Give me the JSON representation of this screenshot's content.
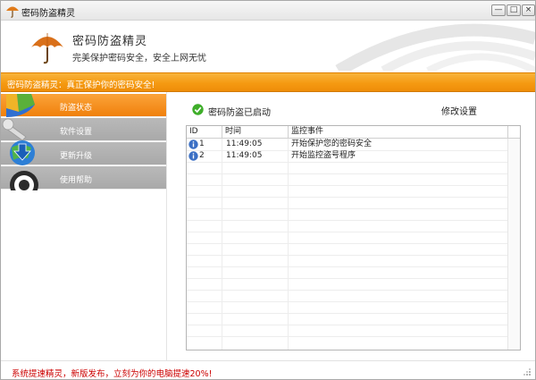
{
  "window": {
    "title": "密码防盗精灵",
    "buttons": {
      "minimize": "—",
      "maximize": "□",
      "close": "×"
    }
  },
  "header": {
    "title": "密码防盗精灵",
    "subtitle": "完美保护密码安全，安全上网无忧",
    "logo_icon": "umbrella-icon"
  },
  "banner": {
    "text": "密码防盗精灵：真正保护你的密码安全!"
  },
  "sidebar": {
    "items": [
      {
        "label": "防盗状态",
        "active": true
      },
      {
        "label": "软件设置",
        "active": false
      },
      {
        "label": "更新升级",
        "active": false
      },
      {
        "label": "使用帮助",
        "active": false
      }
    ]
  },
  "main": {
    "status_text": "密码防盗已启动",
    "status_icon": "check-icon",
    "modify_label": "修改设置",
    "table": {
      "columns": [
        "ID",
        "时间",
        "监控事件"
      ],
      "rows": [
        {
          "id": "1",
          "time": "11:49:05",
          "event": "开始保护您的密码安全",
          "icon": "info-icon"
        },
        {
          "id": "2",
          "time": "11:49:05",
          "event": "开始监控盗号程序",
          "icon": "info-icon"
        }
      ]
    }
  },
  "footer": {
    "text": "系统提速精灵，新版发布，立刻为你的电脑提速20%!"
  },
  "colors": {
    "accent": "#f59a12",
    "footer_text": "#cc0000",
    "nav_inactive": "#b0b0b0"
  }
}
